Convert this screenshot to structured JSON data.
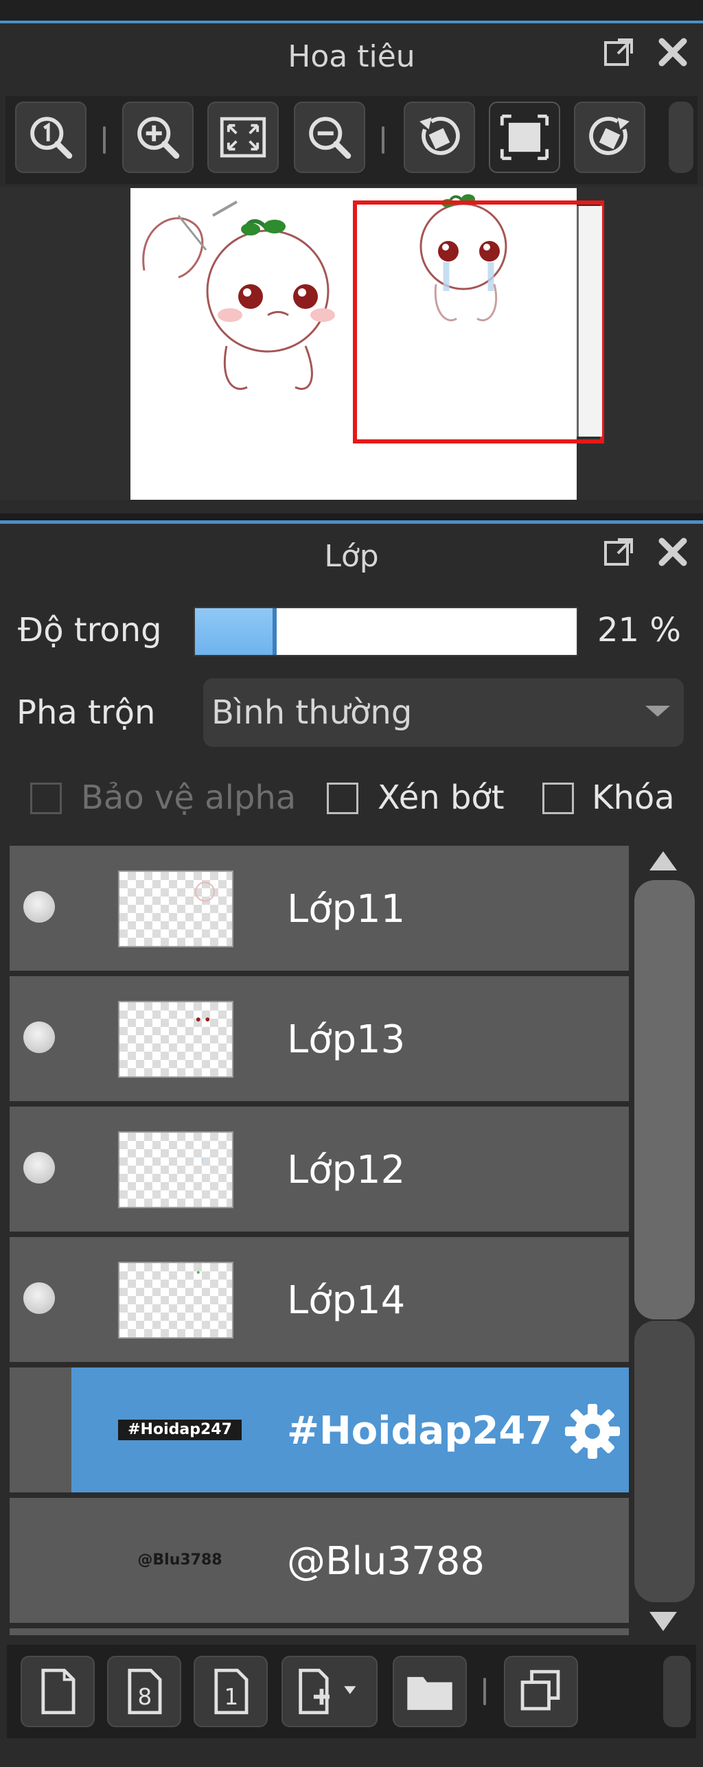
{
  "navigator": {
    "title": "Hoa tiêu",
    "header_icons": [
      "popout-icon",
      "close-icon"
    ],
    "toolbar": [
      {
        "name": "zoom-actual-size-button",
        "icon": "zoom-1-icon"
      },
      {
        "name": "zoom-in-button",
        "icon": "zoom-in-icon"
      },
      {
        "name": "fit-window-button",
        "icon": "fit-icon"
      },
      {
        "name": "zoom-out-button",
        "icon": "zoom-out-icon"
      },
      {
        "name": "rotate-left-button",
        "icon": "rotate-left-icon"
      },
      {
        "name": "reset-view-button",
        "icon": "frame-icon"
      },
      {
        "name": "rotate-right-button",
        "icon": "rotate-right-icon"
      }
    ],
    "viewport_color": "#e51919"
  },
  "layers": {
    "title": "Lớp",
    "opacity": {
      "label": "Độ trong",
      "value": 21,
      "value_text": "21 %"
    },
    "blend": {
      "label": "Pha trộn",
      "selected": "Bình thường"
    },
    "checkboxes": {
      "protect_alpha": {
        "label": "Bảo vệ alpha",
        "checked": false,
        "disabled": true
      },
      "clipping": {
        "label": "Xén bớt",
        "checked": false
      },
      "lock": {
        "label": "Khóa",
        "checked": false
      }
    },
    "items": [
      {
        "name": "Lớp11",
        "visible": true,
        "selected": false
      },
      {
        "name": "Lớp13",
        "visible": true,
        "selected": false
      },
      {
        "name": "Lớp12",
        "visible": true,
        "selected": false
      },
      {
        "name": "Lớp14",
        "visible": true,
        "selected": false
      },
      {
        "name": "#Hoidap247",
        "visible": false,
        "selected": true,
        "thumb_text": "#Hoidap247"
      },
      {
        "name": "@Blu3788",
        "visible": false,
        "selected": false,
        "thumb_text": "@Blu3788"
      }
    ],
    "bottom_toolbar": [
      {
        "name": "new-layer-button",
        "icon": "page-icon"
      },
      {
        "name": "new-8bit-layer-button",
        "icon": "page-8-icon"
      },
      {
        "name": "new-1bit-layer-button",
        "icon": "page-1-icon"
      },
      {
        "name": "add-layer-menu-button",
        "icon": "page-add-icon"
      },
      {
        "name": "new-folder-button",
        "icon": "folder-icon"
      },
      {
        "name": "duplicate-layer-button",
        "icon": "duplicate-icon"
      }
    ],
    "accent_color": "#4f96d3"
  }
}
